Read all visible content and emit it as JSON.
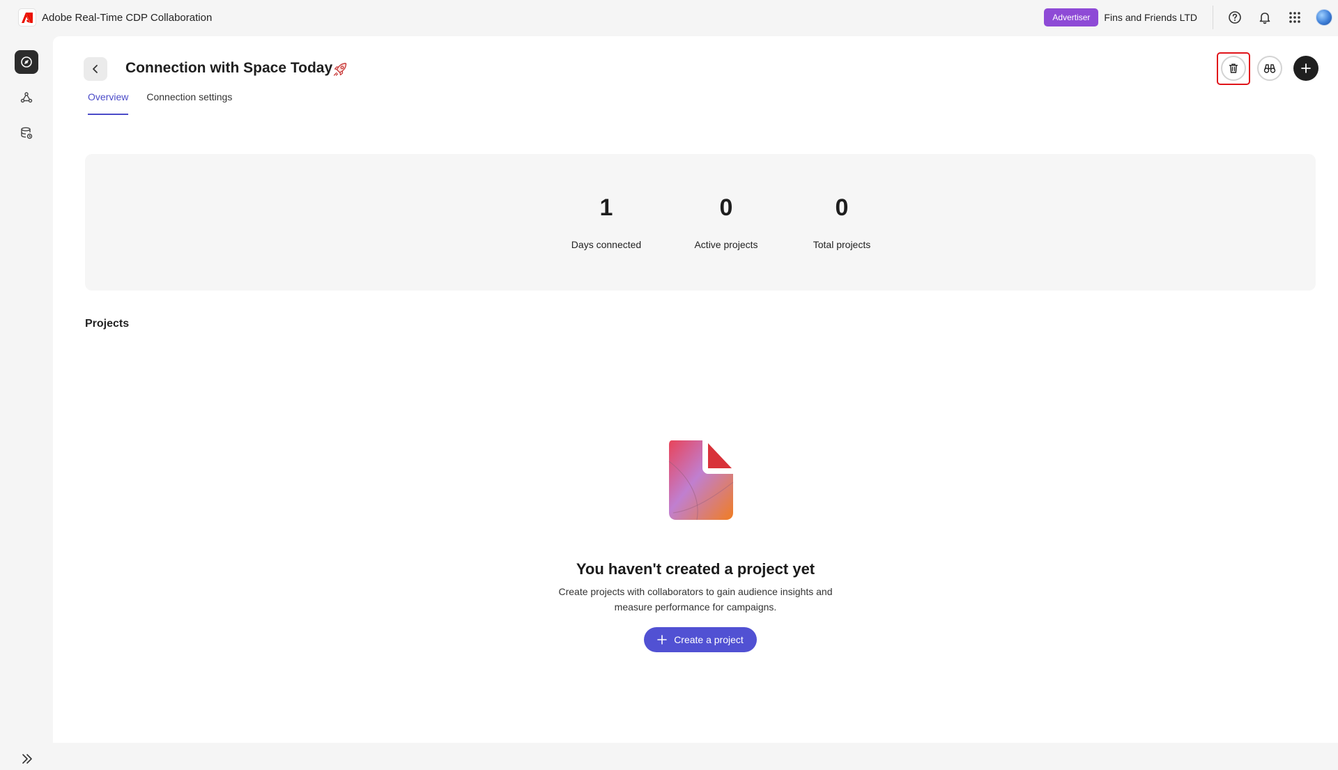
{
  "app": {
    "title": "Adobe Real-Time CDP Collaboration",
    "role_badge": "Advertiser",
    "org_name": "Fins and Friends LTD"
  },
  "top_icons": [
    "help-icon",
    "bell-icon",
    "apps-grid-icon",
    "avatar"
  ],
  "rail": {
    "items": [
      "collaboration-home-icon",
      "connections-icon",
      "data-sources-icon"
    ],
    "expand_icon": "chevron-double-right-icon"
  },
  "header": {
    "title": "Connection with Space Today",
    "title_icon": "rocket-icon",
    "actions": [
      "delete-icon",
      "binoculars-icon",
      "add-icon"
    ]
  },
  "tabs": [
    {
      "label": "Overview",
      "active": true
    },
    {
      "label": "Connection settings",
      "active": false
    }
  ],
  "stats": [
    {
      "value": "1",
      "label": "Days connected"
    },
    {
      "value": "0",
      "label": "Active projects"
    },
    {
      "value": "0",
      "label": "Total projects"
    }
  ],
  "projects": {
    "section_title": "Projects",
    "empty_title": "You haven't created a project yet",
    "empty_desc": "Create projects with collaborators to gain audience insights and measure performance for campaigns.",
    "create_label": "Create a project"
  },
  "colors": {
    "accent": "#5151d3",
    "badge": "#8e4ad6",
    "highlight": "#e0141a"
  }
}
